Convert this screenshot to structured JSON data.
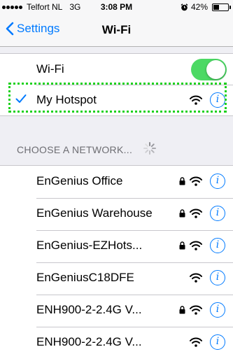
{
  "status_bar": {
    "carrier": "Telfort NL",
    "network": "3G",
    "time": "3:08 PM",
    "battery": "42%",
    "battery_level": 0.42
  },
  "nav": {
    "back_label": "Settings",
    "title": "Wi-Fi"
  },
  "wifi": {
    "label": "Wi-Fi",
    "enabled": true,
    "toggle_color": "#4cd964"
  },
  "connected": {
    "name": "My Hotspot",
    "info": "i"
  },
  "section": {
    "header": "CHOOSE A NETWORK..."
  },
  "networks": [
    {
      "name": "EnGenius Office",
      "locked": true,
      "info": "i"
    },
    {
      "name": "EnGenius Warehouse",
      "locked": true,
      "info": "i"
    },
    {
      "name": "EnGenius-EZHots...",
      "locked": true,
      "info": "i"
    },
    {
      "name": "EnGeniusC18DFE",
      "locked": false,
      "info": "i"
    },
    {
      "name": "ENH900-2-2.4G V...",
      "locked": true,
      "info": "i"
    },
    {
      "name": "ENH900-2-2.4G V...",
      "locked": false,
      "info": "i"
    }
  ],
  "colors": {
    "accent": "#007aff",
    "highlight_outline": "#1fd11f"
  }
}
